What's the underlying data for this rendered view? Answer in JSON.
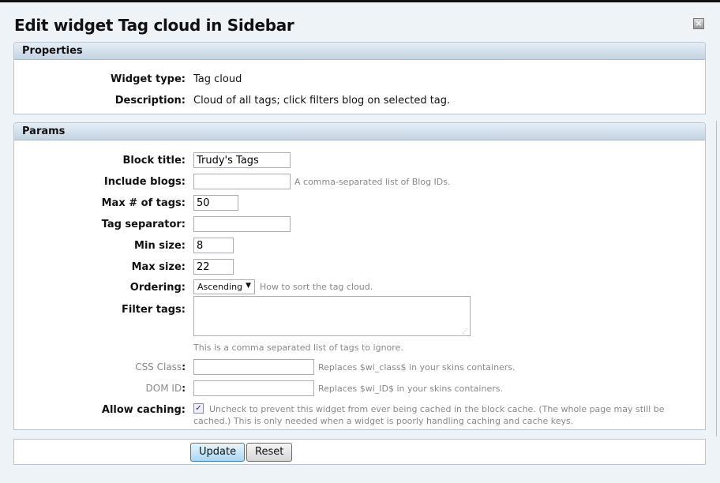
{
  "title": "Edit widget Tag cloud in Sidebar",
  "close_icon": "close-icon",
  "properties": {
    "header": "Properties",
    "widget_type_label": "Widget type:",
    "widget_type": "Tag cloud",
    "description_label": "Description:",
    "description": "Cloud of all tags; click filters blog on selected tag."
  },
  "params": {
    "header": "Params",
    "block_title": {
      "label": "Block title:",
      "value": "Trudy's Tags"
    },
    "include_blogs": {
      "label": "Include blogs:",
      "value": "",
      "hint": "A comma-separated list of Blog IDs."
    },
    "max_tags": {
      "label": "Max # of tags:",
      "value": "50"
    },
    "tag_separator": {
      "label": "Tag separator:",
      "value": ""
    },
    "min_size": {
      "label": "Min size:",
      "value": "8"
    },
    "max_size": {
      "label": "Max size:",
      "value": "22"
    },
    "ordering": {
      "label": "Ordering:",
      "value": "Ascending",
      "hint": "How to sort the tag cloud."
    },
    "filter_tags": {
      "label": "Filter tags:",
      "value": "",
      "hint": "This is a comma separated list of tags to ignore."
    },
    "css_class": {
      "label": "CSS Class",
      "colon": ":",
      "value": "",
      "hint": "Replaces $wi_class$ in your skins containers."
    },
    "dom_id": {
      "label": "DOM ID",
      "colon": ":",
      "value": "",
      "hint": "Replaces $wi_ID$ in your skins containers."
    },
    "allow_caching": {
      "label": "Allow caching:",
      "checked": true,
      "hint": "Uncheck to prevent this widget from ever being cached in the block cache. (The whole page may still be cached.) This is only needed when a widget is poorly handling caching and cache keys."
    }
  },
  "buttons": {
    "update": "Update",
    "reset": "Reset"
  }
}
